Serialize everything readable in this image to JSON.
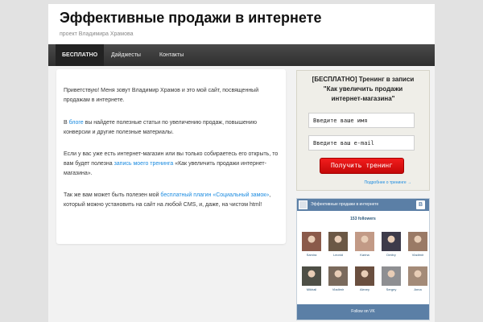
{
  "site": {
    "title": "Эффективные продажи в интернете",
    "description": "проект Владимира Храмова"
  },
  "nav": {
    "items": [
      "БЕСПЛАТНО",
      "Дайджесты",
      "Контакты"
    ]
  },
  "content": {
    "p1": "Приветствую! Меня зовут Владимир Храмов и это мой сайт, посвященный продажам в интернете.",
    "p2_pre": "В ",
    "p2_link": "блоге",
    "p2_post": " вы найдете полезные статьи по увеличению продаж, повышению конверсии и другие полезные материалы.",
    "p3_pre": "Если у вас уже есть интернет-магазин или вы только собираетесь его открыть, то вам будет полезна ",
    "p3_link": "запись моего тренинга",
    "p3_post": " «Как увеличить продажи интернет-магазина».",
    "p4_pre": "Так же вам может быть полезен мой ",
    "p4_link": "бесплатный плагин «Социальный замок»",
    "p4_post": ", который можно установить на сайт на любой CMS, и, даже, на чистом html!"
  },
  "promo": {
    "title_line1": "[БЕСПЛАТНО] Тренинг в записи",
    "title_line2": "\"Как увеличить продажи",
    "title_line3": "интернет-магазина\"",
    "name_placeholder": "Введите ваше имя",
    "email_placeholder": "Введите ваш e-mail",
    "button_label": "Получить тренинг",
    "more_link": "Подробнее о тренинге →"
  },
  "vk": {
    "group_title": "Эффективные продажи в интернете",
    "logo": "В",
    "followers": "153 followers",
    "members": [
      {
        "name": "Samira",
        "color": "#8a5a4a"
      },
      {
        "name": "Leonid",
        "color": "#6b5845"
      },
      {
        "name": "Karina",
        "color": "#c29a86"
      },
      {
        "name": "Dmitry",
        "color": "#3d3b4a"
      },
      {
        "name": "Vladimir",
        "color": "#9a7a66"
      },
      {
        "name": "Mikhail",
        "color": "#4e4f46"
      },
      {
        "name": "Vladimir",
        "color": "#7a6a5c"
      },
      {
        "name": "Alexey",
        "color": "#6a4f3f"
      },
      {
        "name": "Sergey",
        "color": "#8e8f92"
      },
      {
        "name": "Anna",
        "color": "#a48b78"
      }
    ],
    "follow_label": "Follow on VK"
  }
}
